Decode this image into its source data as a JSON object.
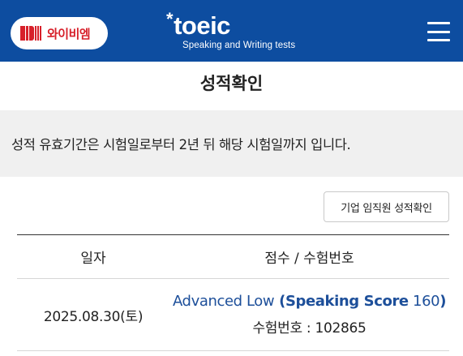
{
  "header": {
    "ybm_logo_text": "와이비엠",
    "toeic_brand": "toeic",
    "toeic_star": "*",
    "toeic_subtitle": "Speaking and Writing tests",
    "menu_icon": "hamburger-menu-icon",
    "background_color": "#0d4da0",
    "logo_accent_color": "#d7202a"
  },
  "page": {
    "title": "성적확인",
    "notice": "성적 유효기간은 시험일로부터 2년 뒤 해당 시험일까지 입니다.",
    "corporate_button_label": "기업 임직원 성적확인"
  },
  "table": {
    "headers": {
      "date": "일자",
      "score": "점수 / 수험번호"
    },
    "rows": [
      {
        "date": "2025.08.30(토)",
        "level": "Advanced Low",
        "score_open": " (",
        "score_label": "Speaking Score",
        "score_value": " 160",
        "score_close": ")",
        "exam_number": "수험번호 : 102865"
      }
    ]
  }
}
